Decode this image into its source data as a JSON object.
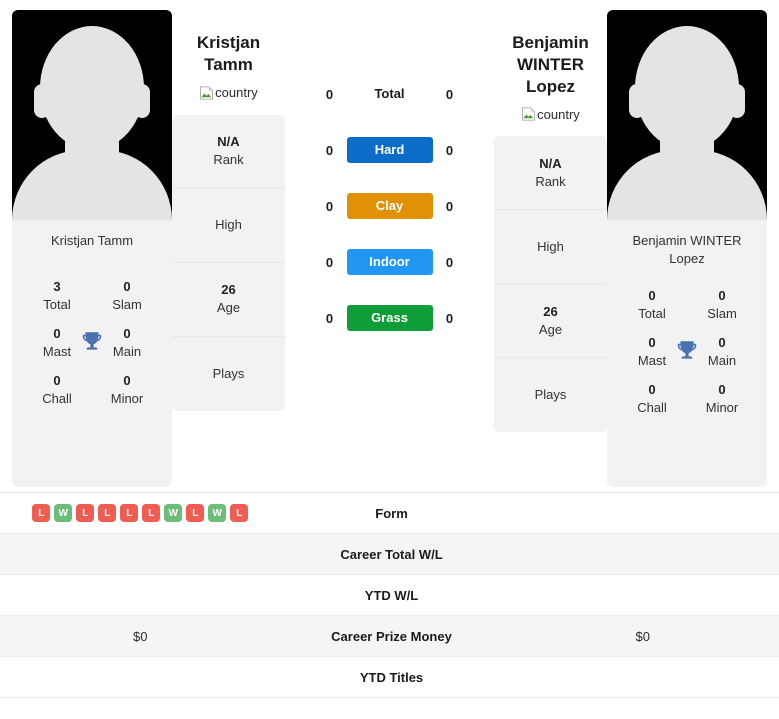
{
  "players": {
    "left": {
      "name_line1": "Kristjan",
      "name_line2": "Tamm",
      "full_name": "Kristjan Tamm",
      "country_alt": "country",
      "photo_caption": "Kristjan Tamm",
      "titles": [
        {
          "num": "3",
          "lbl": "Total"
        },
        {
          "num": "0",
          "lbl": "Slam"
        },
        {
          "num": "0",
          "lbl": "Mast"
        },
        {
          "num": "0",
          "lbl": "Main"
        },
        {
          "num": "0",
          "lbl": "Chall"
        },
        {
          "num": "0",
          "lbl": "Minor"
        }
      ],
      "info": [
        {
          "value": "N/A",
          "label": "Rank"
        },
        {
          "value": "",
          "label": "High"
        },
        {
          "value": "26",
          "label": "Age"
        },
        {
          "value": "",
          "label": "Plays"
        }
      ]
    },
    "right": {
      "name_line1": "Benjamin",
      "name_line2": "WINTER Lopez",
      "full_name": "Benjamin WINTER Lopez",
      "country_alt": "country",
      "photo_caption_line1": "Benjamin WINTER",
      "photo_caption_line2": "Lopez",
      "titles": [
        {
          "num": "0",
          "lbl": "Total"
        },
        {
          "num": "0",
          "lbl": "Slam"
        },
        {
          "num": "0",
          "lbl": "Mast"
        },
        {
          "num": "0",
          "lbl": "Main"
        },
        {
          "num": "0",
          "lbl": "Chall"
        },
        {
          "num": "0",
          "lbl": "Minor"
        }
      ],
      "info": [
        {
          "value": "N/A",
          "label": "Rank"
        },
        {
          "value": "",
          "label": "High"
        },
        {
          "value": "26",
          "label": "Age"
        },
        {
          "value": "",
          "label": "Plays"
        }
      ]
    }
  },
  "surfaces": [
    {
      "label": "Total",
      "left": "0",
      "right": "0",
      "color": ""
    },
    {
      "label": "Hard",
      "left": "0",
      "right": "0",
      "color": "#0b6dc7"
    },
    {
      "label": "Clay",
      "left": "0",
      "right": "0",
      "color": "#e09106"
    },
    {
      "label": "Indoor",
      "left": "0",
      "right": "0",
      "color": "#2196f3"
    },
    {
      "label": "Grass",
      "left": "0",
      "right": "0",
      "color": "#0f9d3a"
    }
  ],
  "comparison_rows": [
    {
      "label": "Form",
      "left": "",
      "right": "",
      "left_form": [
        "L",
        "W",
        "L",
        "L",
        "L",
        "L",
        "W",
        "L",
        "W",
        "L"
      ]
    },
    {
      "label": "Career Total W/L",
      "left": "",
      "right": ""
    },
    {
      "label": "YTD W/L",
      "left": "",
      "right": ""
    },
    {
      "label": "Career Prize Money",
      "left": "$0",
      "right": "$0"
    },
    {
      "label": "YTD Titles",
      "left": "",
      "right": ""
    }
  ],
  "colors": {
    "win": "#6cbd78",
    "loss": "#ef5d52",
    "trophy": "#4a72b0",
    "card_bg": "#f2f2f2"
  }
}
